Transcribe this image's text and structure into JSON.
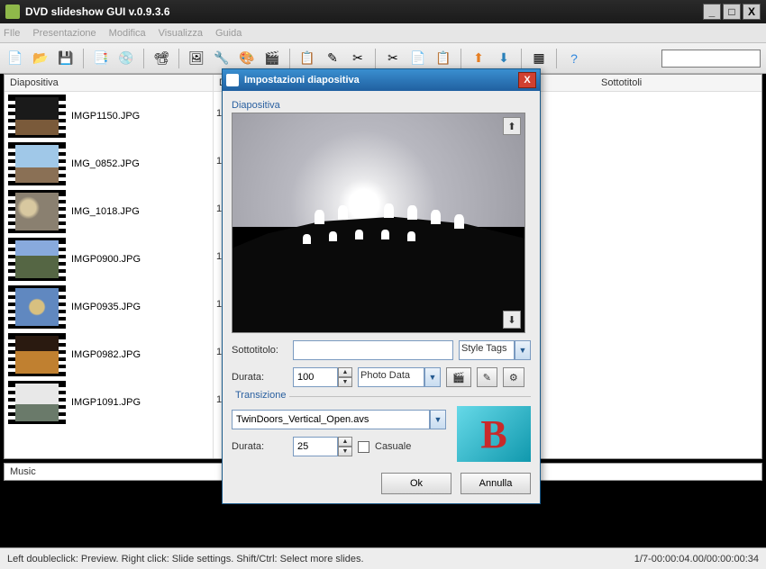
{
  "app": {
    "title": "DVD slideshow GUI v.0.9.3.6"
  },
  "menu": {
    "file": "FIle",
    "presentazione": "Presentazione",
    "modifica": "Modifica",
    "visualizza": "Visualizza",
    "guida": "Guida"
  },
  "columns": {
    "slide": "Diapositiva",
    "duration": "Du",
    "subtitle": "Sottotitoli"
  },
  "slides": [
    {
      "name": "IMGP1150.JPG",
      "dur": "1"
    },
    {
      "name": "IMG_0852.JPG",
      "dur": "1"
    },
    {
      "name": "IMG_1018.JPG",
      "dur": "1"
    },
    {
      "name": "IMGP0900.JPG",
      "dur": "1"
    },
    {
      "name": "IMGP0935.JPG",
      "dur": "1"
    },
    {
      "name": "IMGP0982.JPG",
      "dur": "1"
    },
    {
      "name": "IMGP1091.JPG",
      "dur": "1"
    }
  ],
  "music": {
    "label": "Music"
  },
  "status": {
    "left": "Left doubleclick: Preview. Right click: Slide settings. Shift/Ctrl: Select more slides.",
    "right": "1/7-00:00:04.00/00:00:00:34"
  },
  "dialog": {
    "title": "Impostazioni diapositiva",
    "group_slide": "Diapositiva",
    "subtitle_label": "Sottotitolo:",
    "subtitle_value": "",
    "style_tags": "Style Tags",
    "duration_label": "Durata:",
    "duration_value": "100",
    "photo_data": "Photo Data",
    "group_trans": "Transizione",
    "trans_value": "TwinDoors_Vertical_Open.avs",
    "trans_dur_label": "Durata:",
    "trans_dur_value": "25",
    "random_label": "Casuale",
    "ok": "Ok",
    "cancel": "Annulla"
  }
}
